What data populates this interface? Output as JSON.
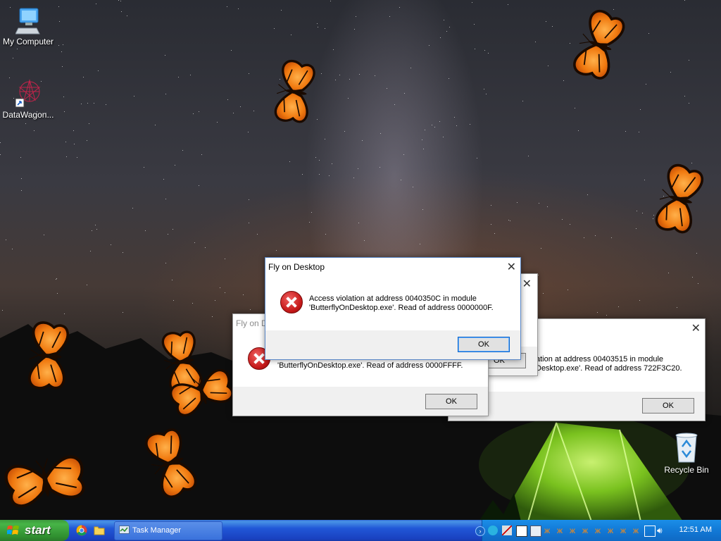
{
  "desktop": {
    "icons": [
      {
        "label": "My Computer"
      },
      {
        "label": "DataWagon..."
      },
      {
        "label": "Recycle Bin"
      }
    ]
  },
  "dialogs": {
    "front": {
      "title": "Fly on Desktop",
      "line1": "Access violation at address 0040350C in module",
      "line2": "'ButterflyOnDesktop.exe'. Read of address 0000000F.",
      "ok_label": "OK"
    },
    "left": {
      "title": "Fly on D",
      "line2": "'ButterflyOnDesktop.exe'. Read of address 0000FFFF.",
      "ok_label": "OK"
    },
    "middle": {
      "ok_label": "OK"
    },
    "right": {
      "line1": "ation at address 00403515 in module",
      "line2": "Desktop.exe'. Read of address 722F3C20.",
      "ok_label": "OK"
    }
  },
  "taskbar": {
    "start_label": "start",
    "task_manager_label": "Task Manager",
    "clock": "12:51 AM"
  },
  "colors": {
    "taskbar_blue": "#2157d7",
    "start_green": "#3c9a3c",
    "error_red": "#c41818"
  }
}
